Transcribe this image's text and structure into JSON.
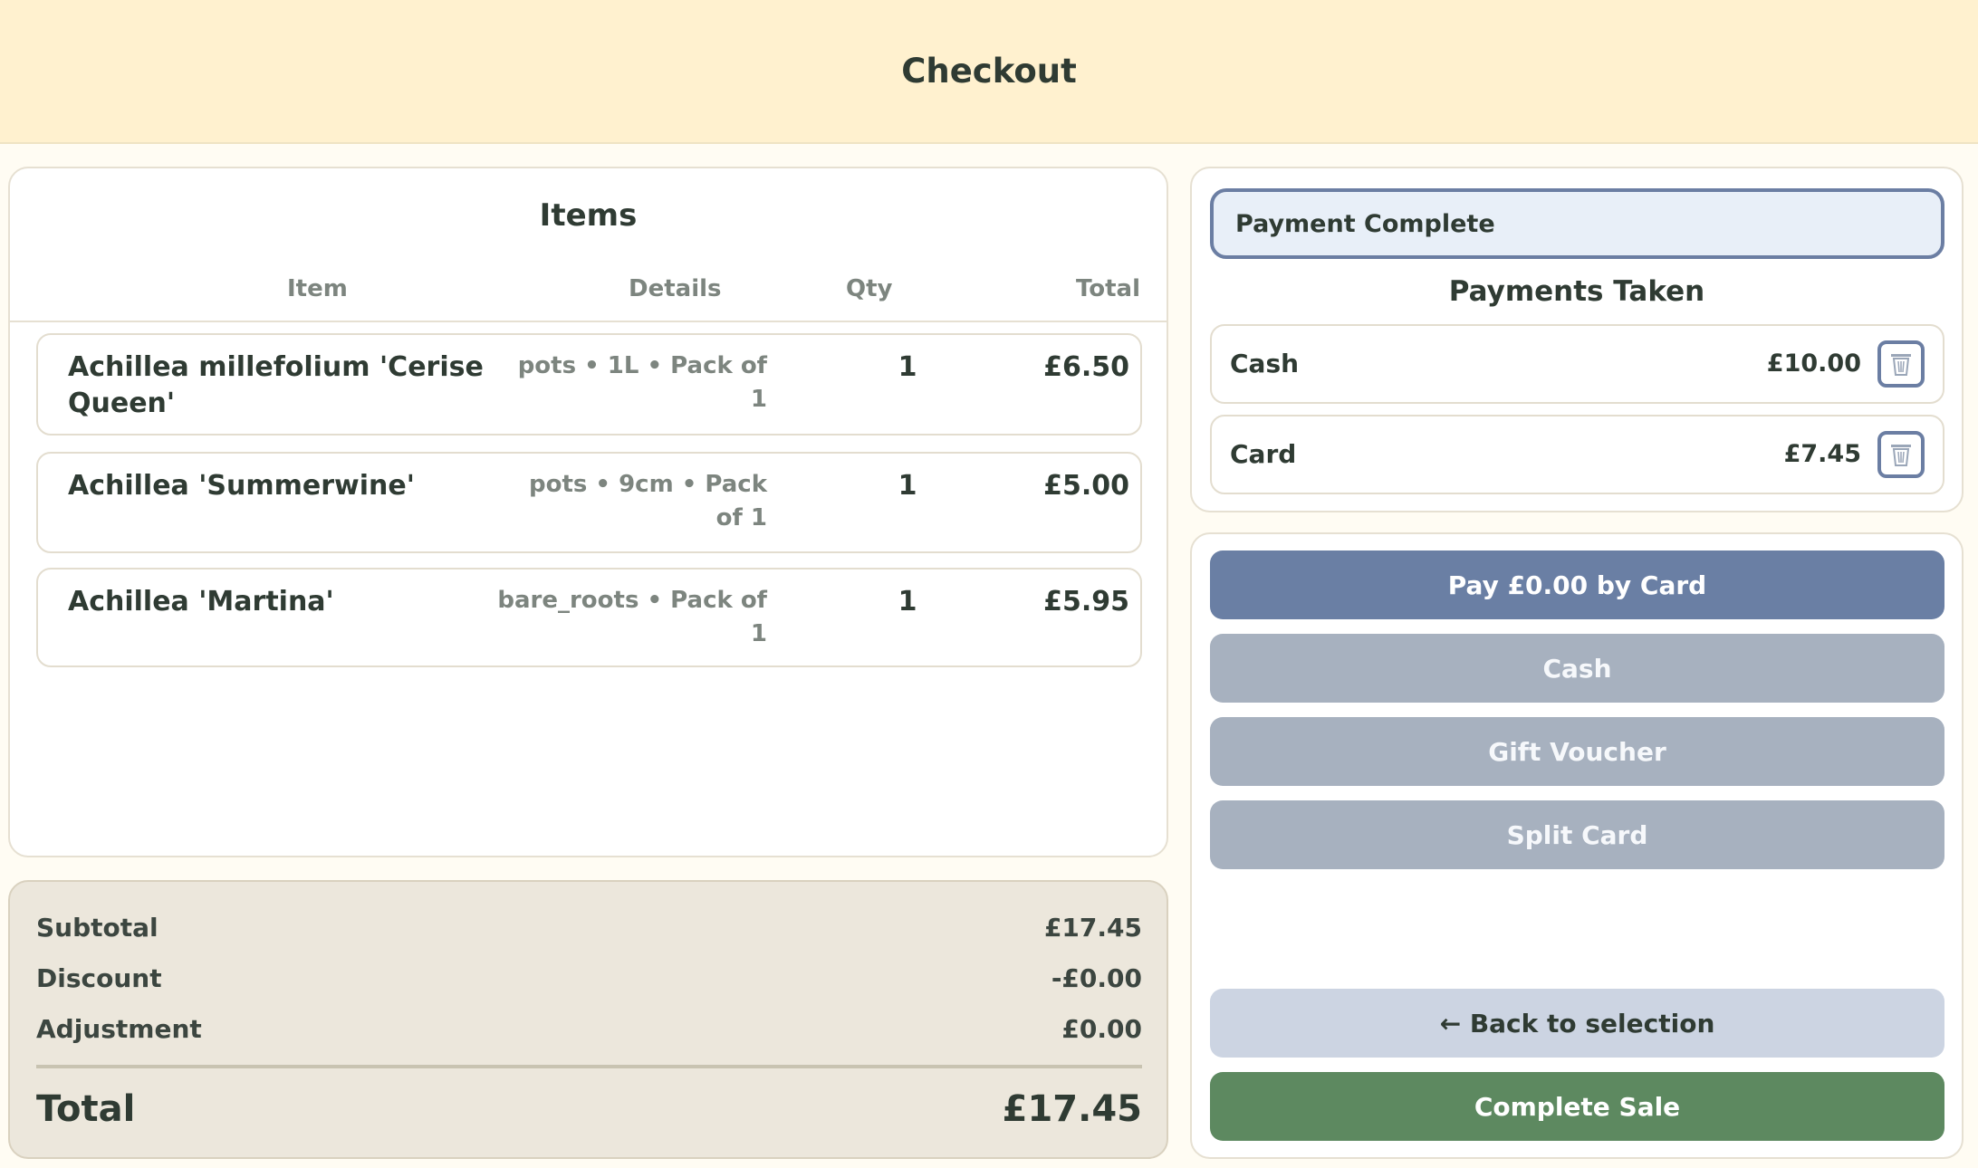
{
  "header": {
    "title": "Checkout"
  },
  "items": {
    "title": "Items",
    "columns": {
      "item": "Item",
      "details": "Details",
      "qty": "Qty",
      "total": "Total"
    },
    "rows": [
      {
        "name": "Achillea millefolium 'Cerise Queen'",
        "details": "pots • 1L • Pack of 1",
        "qty": "1",
        "total": "£6.50"
      },
      {
        "name": "Achillea 'Summerwine'",
        "details": "pots • 9cm • Pack of 1",
        "qty": "1",
        "total": "£5.00"
      },
      {
        "name": "Achillea 'Martina'",
        "details": "bare_roots • Pack of 1",
        "qty": "1",
        "total": "£5.95"
      }
    ]
  },
  "totals": {
    "subtotal_label": "Subtotal",
    "subtotal": "£17.45",
    "discount_label": "Discount",
    "discount": "-£0.00",
    "adjustment_label": "Adjustment",
    "adjustment": "£0.00",
    "total_label": "Total",
    "total": "£17.45"
  },
  "payments": {
    "status": "Payment Complete",
    "title": "Payments Taken",
    "list": [
      {
        "method": "Cash",
        "amount": "£10.00",
        "icon": "trash-icon"
      },
      {
        "method": "Card",
        "amount": "£7.45",
        "icon": "trash-icon"
      }
    ]
  },
  "actions": {
    "pay_card": "Pay £0.00 by Card",
    "cash": "Cash",
    "gift_voucher": "Gift Voucher",
    "split_card": "Split Card",
    "back": "← Back to selection",
    "complete": "Complete Sale"
  },
  "colors": {
    "header_bg": "#fff1cf",
    "primary": "#6a7fa4",
    "muted": "#a7b1bf",
    "complete": "#5d8960",
    "totals_bg": "#ece7dc"
  }
}
